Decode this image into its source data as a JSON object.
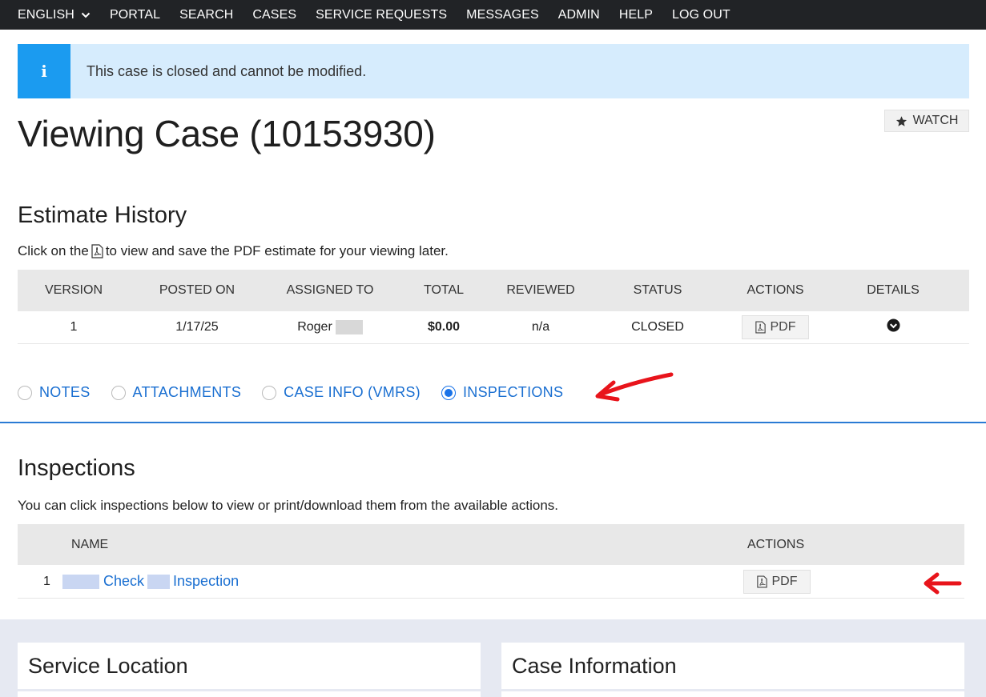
{
  "nav": {
    "items": [
      "ENGLISH",
      "PORTAL",
      "SEARCH",
      "CASES",
      "SERVICE REQUESTS",
      "MESSAGES",
      "ADMIN",
      "HELP",
      "LOG OUT"
    ],
    "icons": {
      "language_dropdown": "chevron-down-icon"
    }
  },
  "alert": {
    "icon_glyph": "i",
    "text": "This case is closed and cannot be modified.",
    "colors": {
      "icon_bg": "#1b9bf0",
      "bg": "#d6ecfd"
    }
  },
  "page": {
    "title": "Viewing Case (10153930)",
    "watch_label": "WATCH"
  },
  "estimate_history": {
    "title": "Estimate History",
    "help_before": "Click on the",
    "help_after": "to view and save the PDF estimate for your viewing later.",
    "columns": [
      "VERSION",
      "POSTED ON",
      "ASSIGNED TO",
      "TOTAL",
      "REVIEWED",
      "STATUS",
      "ACTIONS",
      "DETAILS"
    ],
    "rows": [
      {
        "version": "1",
        "posted_on": "1/17/25",
        "assigned_to": "Roger",
        "total": "$0.00",
        "reviewed": "n/a",
        "status": "CLOSED",
        "action_label": "PDF"
      }
    ]
  },
  "tabs": [
    {
      "label": "NOTES",
      "checked": false
    },
    {
      "label": "ATTACHMENTS",
      "checked": false
    },
    {
      "label": "CASE INFO (VMRS)",
      "checked": false
    },
    {
      "label": "INSPECTIONS",
      "checked": true
    }
  ],
  "inspections": {
    "title": "Inspections",
    "help": "You can click inspections below to view or print/download them from the available actions.",
    "columns": [
      "NAME",
      "ACTIONS"
    ],
    "rows": [
      {
        "index": "1",
        "name_part1": "Check",
        "name_part2": "Inspection",
        "action_label": "PDF"
      }
    ]
  },
  "panels": {
    "left_title": "Service Location",
    "right_title": "Case Information"
  },
  "colors": {
    "accent": "#1a6fd1",
    "nav_bg": "#212326",
    "annotation_arrow": "#e8141b"
  }
}
